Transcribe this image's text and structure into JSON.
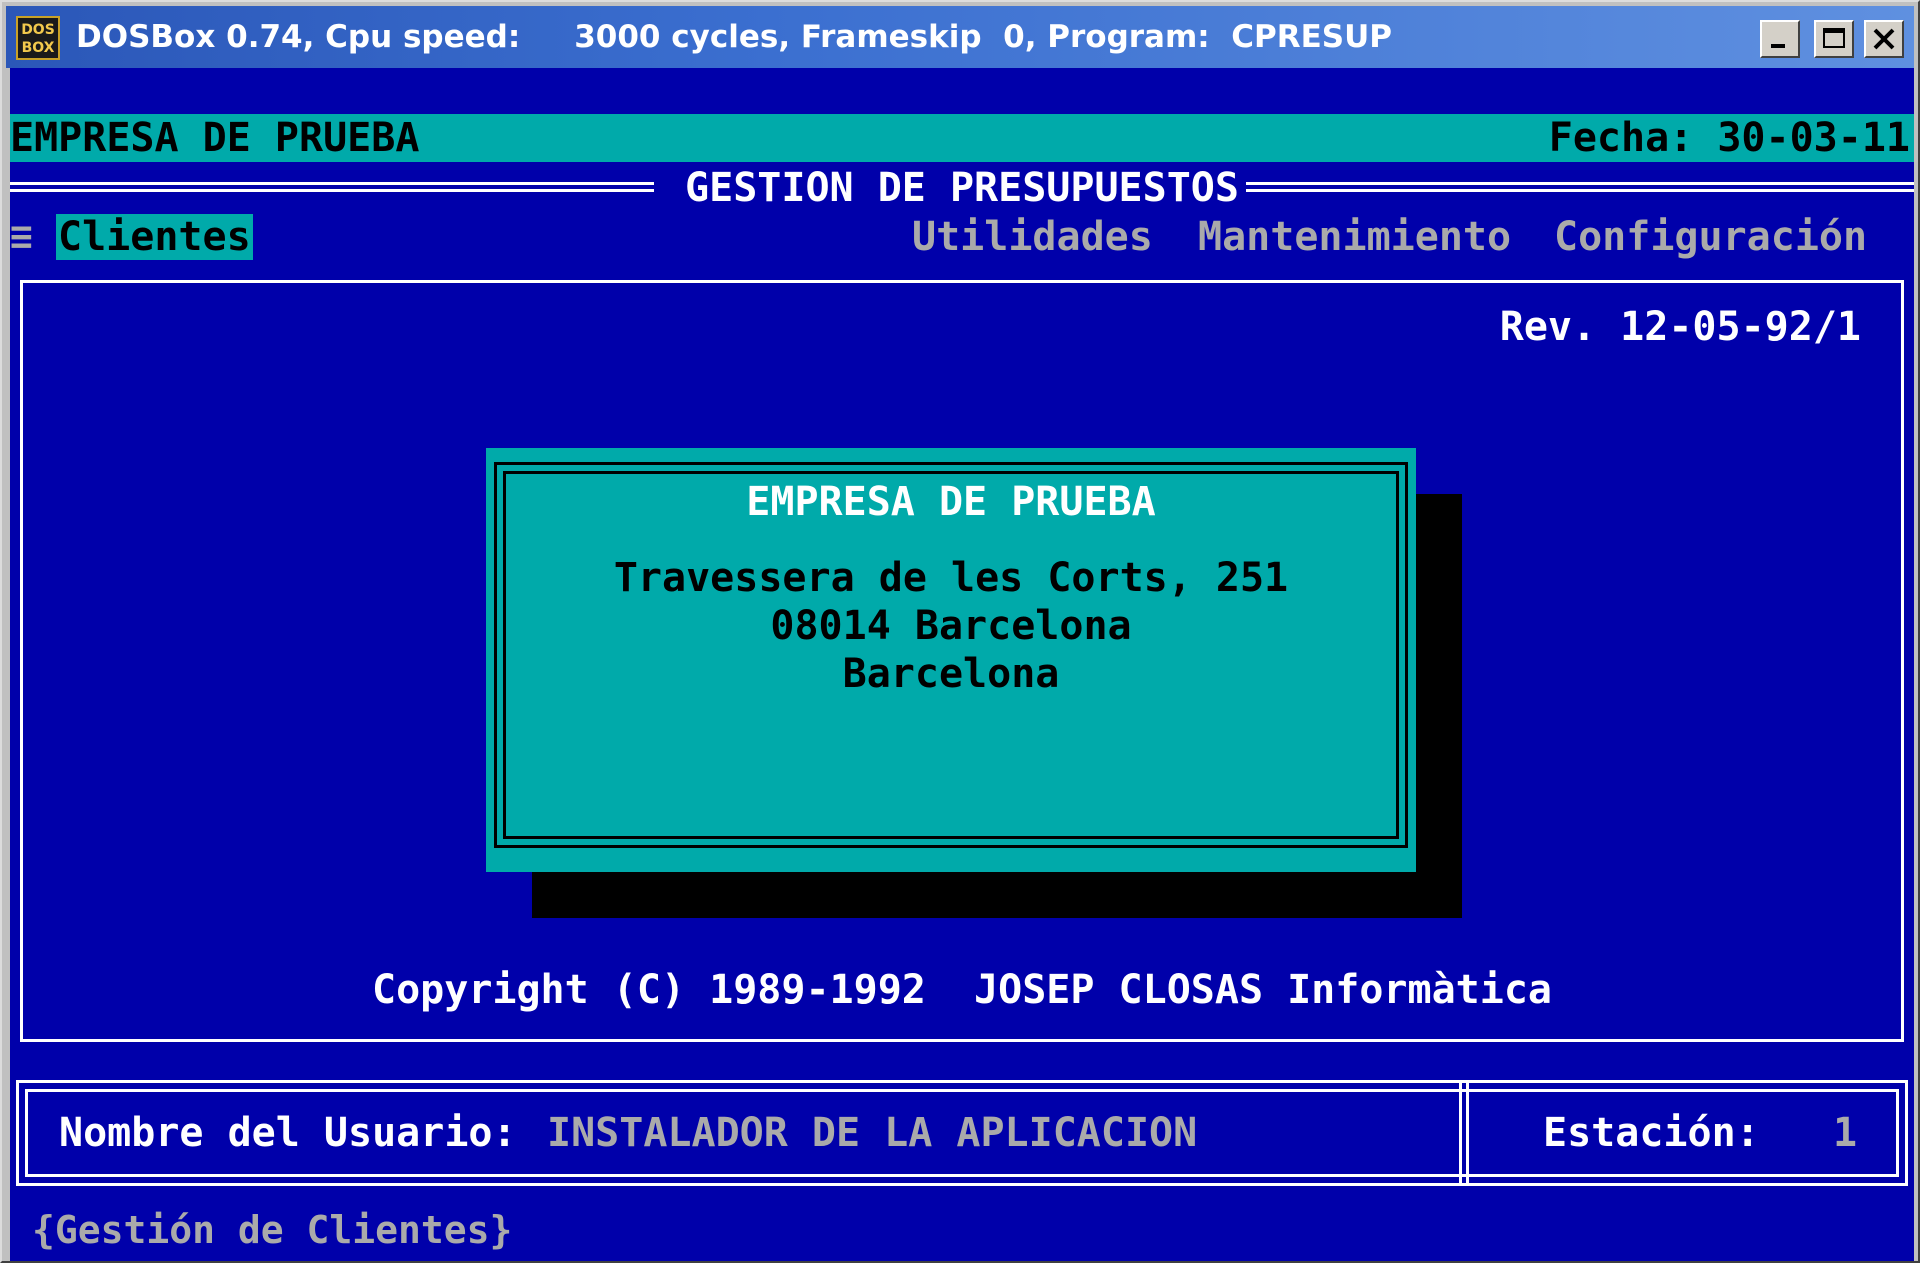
{
  "window": {
    "title": "DOSBox 0.74, Cpu speed:     3000 cycles, Frameskip  0, Program:  CPRESUP",
    "icon_text": "DOS BOX",
    "controls": [
      "minimize-icon",
      "maximize-icon",
      "close-icon"
    ]
  },
  "header": {
    "company": "EMPRESA DE PRUEBA",
    "date": "Fecha: 30-03-11"
  },
  "main_title": "GESTION DE PRESUPUESTOS",
  "menu": {
    "glyph": "≡",
    "items": [
      {
        "label": "Clientes",
        "active": true
      },
      {
        "label": "Utilidades",
        "active": false
      },
      {
        "label": "Mantenimiento",
        "active": false
      },
      {
        "label": "Configuración",
        "active": false
      }
    ]
  },
  "revision": "Rev. 12-05-92/1",
  "dialog": {
    "title": "EMPRESA DE PRUEBA",
    "address_line1": "Travessera de les Corts, 251",
    "address_line2": "08014 Barcelona",
    "address_line3": "Barcelona"
  },
  "copyright": "Copyright (C) 1989-1992  JOSEP CLOSAS Informàtica",
  "status": {
    "user_label": "Nombre del Usuario:",
    "user_value": "INSTALADOR DE LA APLICACION",
    "station_label": "Estación:",
    "station_value": "1"
  },
  "help_line": "{Gestión de Clientes}",
  "colors": {
    "screen_blue": "#0000aa",
    "cyan": "#00aaaa",
    "gray_text": "#aaaaaa",
    "white": "#ffffff",
    "black": "#000000"
  }
}
